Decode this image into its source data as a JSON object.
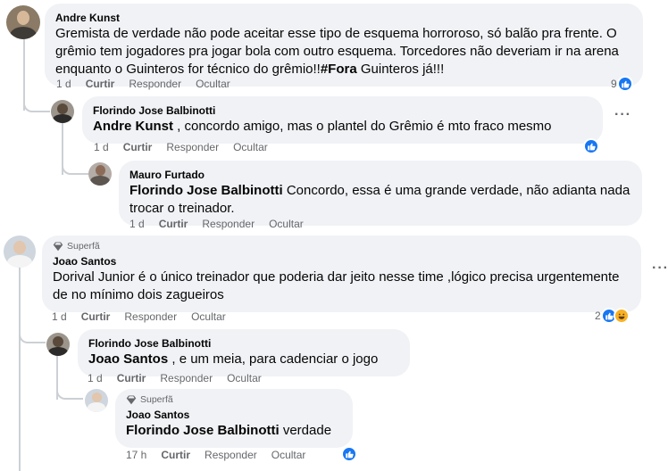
{
  "actions": {
    "like": "Curtir",
    "reply": "Responder",
    "hide": "Ocultar"
  },
  "comments": [
    {
      "author": "Andre Kunst",
      "text": "Gremista de verdade não pode aceitar esse tipo de esquema horroroso, só balão pra frente. O grêmio tem jogadores pra jogar bola com outro esquema. Torcedores não deveriam ir na arena enquanto o Guinteros for técnico do grêmio!!",
      "hashtag": "#Fora",
      "text_end": " Guinteros já!!!",
      "time": "1 d",
      "reaction_count": "9"
    },
    {
      "author": "Florindo Jose Balbinotti",
      "mention": "Andre Kunst",
      "text": " , concordo amigo, mas o plantel do Grêmio é mto fraco mesmo",
      "time": "1 d"
    },
    {
      "author": "Mauro Furtado",
      "mention": "Florindo Jose Balbinotti",
      "text": " Concordo, essa é uma grande verdade, não adianta nada trocar o treinador.",
      "time": "1 d"
    },
    {
      "badge": "Superfã",
      "author": "Joao Santos",
      "text": "Dorival Junior é o único treinador que poderia dar jeito nesse time ,lógico precisa urgentemente de no mínimo dois zagueiros",
      "time": "1 d",
      "reaction_count": "2"
    },
    {
      "author": "Florindo Jose Balbinotti",
      "mention": "Joao Santos",
      "text": " , e um meia, para cadenciar o jogo",
      "time": "1 d"
    },
    {
      "badge": "Superfã",
      "author": "Joao Santos",
      "mention": "Florindo Jose Balbinotti",
      "text": " verdade",
      "time": "17 h"
    }
  ],
  "more_label": "···",
  "colors": {
    "like_blue": "#1877f2",
    "bubble_bg": "#f0f2f5",
    "meta_gray": "#65676b"
  }
}
